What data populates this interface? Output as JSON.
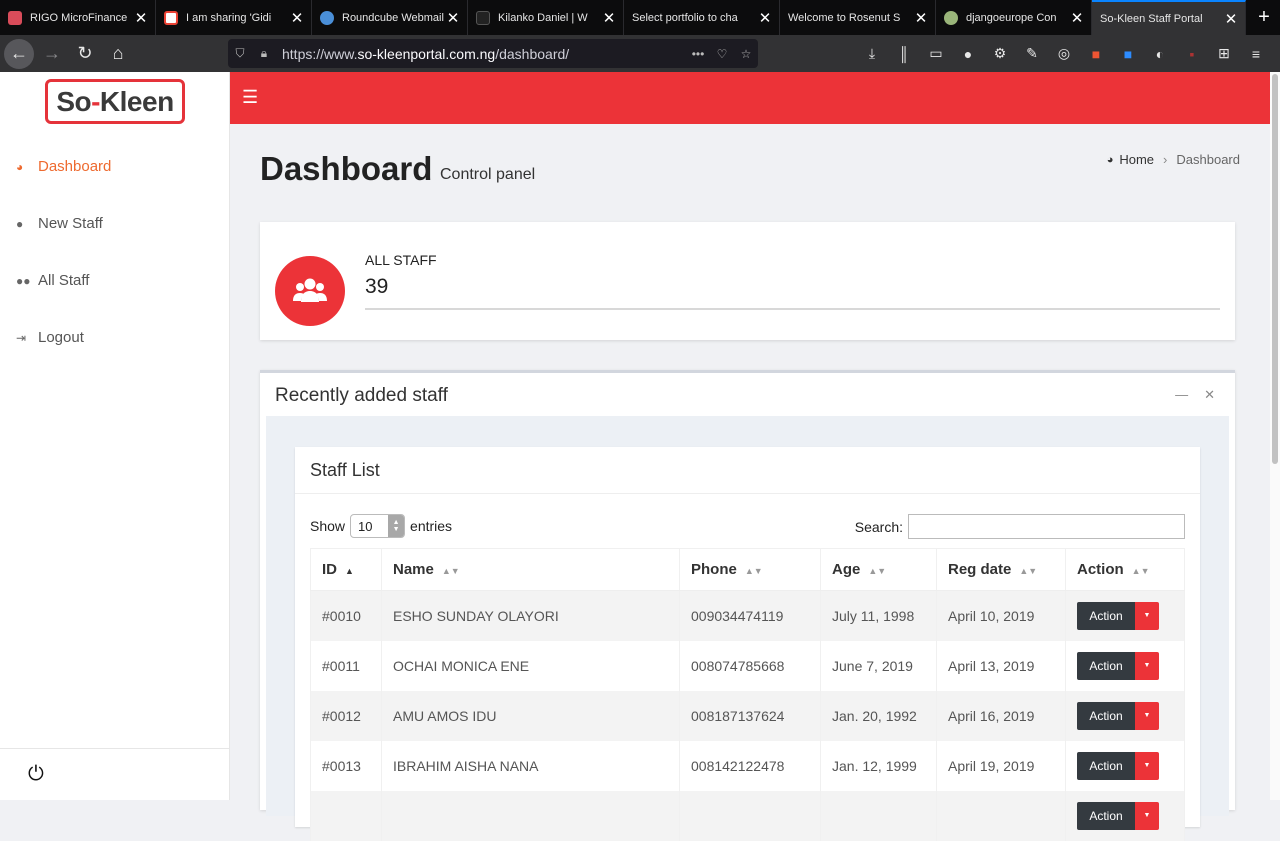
{
  "browser": {
    "tabs": [
      {
        "title": "RIGO MicroFinance",
        "color": "#d94c5a"
      },
      {
        "title": "I am sharing 'Gidi",
        "color": "#ea4335"
      },
      {
        "title": "Roundcube Webmail",
        "color": "#4a8fd8"
      },
      {
        "title": "Kilanko Daniel | W",
        "color": "#222222"
      },
      {
        "title": "Select portfolio to cha",
        "color": "#0c0c0d"
      },
      {
        "title": "Welcome to Rosenut S",
        "color": "#0c0c0d"
      },
      {
        "title": "djangoeurope Con",
        "color": "#9ab57a"
      },
      {
        "title": "So-Kleen Staff Portal",
        "color": "#323234"
      }
    ],
    "new_tab": "+",
    "url_prefix": "https://www.",
    "url_domain": "so-kleenportal.com.ng",
    "url_path": "/dashboard/"
  },
  "sidebar": {
    "logo_part1": "So",
    "logo_dash": "-",
    "logo_part2": "Kleen",
    "items": [
      {
        "label": "Dashboard",
        "icon": "dashboard-icon"
      },
      {
        "label": "New Staff",
        "icon": "user-icon"
      },
      {
        "label": "All Staff",
        "icon": "users-icon"
      },
      {
        "label": "Logout",
        "icon": "sign-out-icon"
      }
    ],
    "power_icon": "⏻"
  },
  "header": {
    "menu_icon": "☰",
    "accent": "#ec3338"
  },
  "page": {
    "title": "Dashboard",
    "subtitle": "Control panel",
    "breadcrumb_home": "Home",
    "breadcrumb_current": "Dashboard"
  },
  "stat": {
    "label": "ALL STAFF",
    "value": "39"
  },
  "recent": {
    "title": "Recently added staff",
    "card_title": "Staff List",
    "show_label": "Show",
    "entries_value": "10",
    "entries_label": "entries",
    "search_label": "Search:",
    "search_value": "",
    "columns": [
      "ID",
      "Name",
      "Phone",
      "Age",
      "Reg date",
      "Action"
    ],
    "rows": [
      {
        "id": "#0010",
        "name": "ESHO SUNDAY OLAYORI",
        "phone": "009034474119",
        "age": "July 11, 1998",
        "reg": "April 10, 2019",
        "action": "Action"
      },
      {
        "id": "#0011",
        "name": "OCHAI MONICA ENE",
        "phone": "008074785668",
        "age": "June 7, 2019",
        "reg": "April 13, 2019",
        "action": "Action"
      },
      {
        "id": "#0012",
        "name": "AMU AMOS IDU",
        "phone": "008187137624",
        "age": "Jan. 20, 1992",
        "reg": "April 16, 2019",
        "action": "Action"
      },
      {
        "id": "#0013",
        "name": "IBRAHIM AISHA NANA",
        "phone": "008142122478",
        "age": "Jan. 12, 1999",
        "reg": "April 19, 2019",
        "action": "Action"
      },
      {
        "id": "",
        "name": "",
        "phone": "",
        "age": "",
        "reg": "",
        "action": "Action"
      }
    ]
  }
}
